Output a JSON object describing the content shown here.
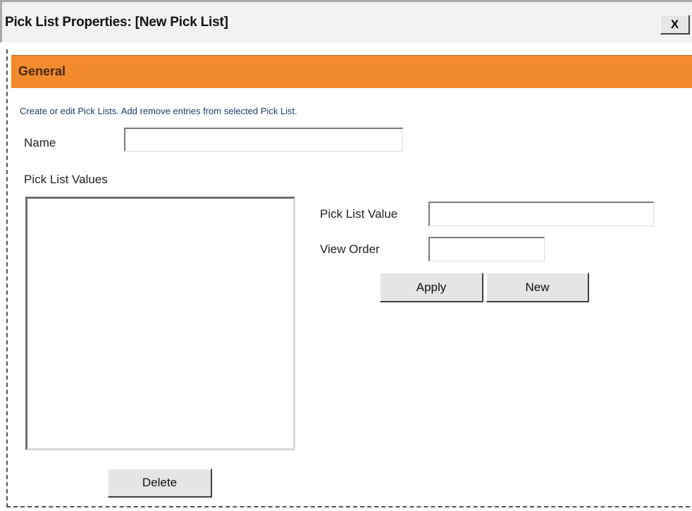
{
  "dialog": {
    "title": "Pick List Properties: [New Pick List]",
    "close_label": "X"
  },
  "section": {
    "title": "General",
    "description": "Create or edit Pick Lists. Add remove entries from selected Pick List."
  },
  "form": {
    "name_label": "Name",
    "name_value": "",
    "values_label": "Pick List Values",
    "pick_list_value_label": "Pick List Value",
    "pick_list_value": "",
    "view_order_label": "View Order",
    "view_order_value": ""
  },
  "buttons": {
    "apply": "Apply",
    "new": "New",
    "delete": "Delete"
  },
  "colors": {
    "header_accent": "#f28a2e",
    "description_text": "#1f3b66"
  }
}
